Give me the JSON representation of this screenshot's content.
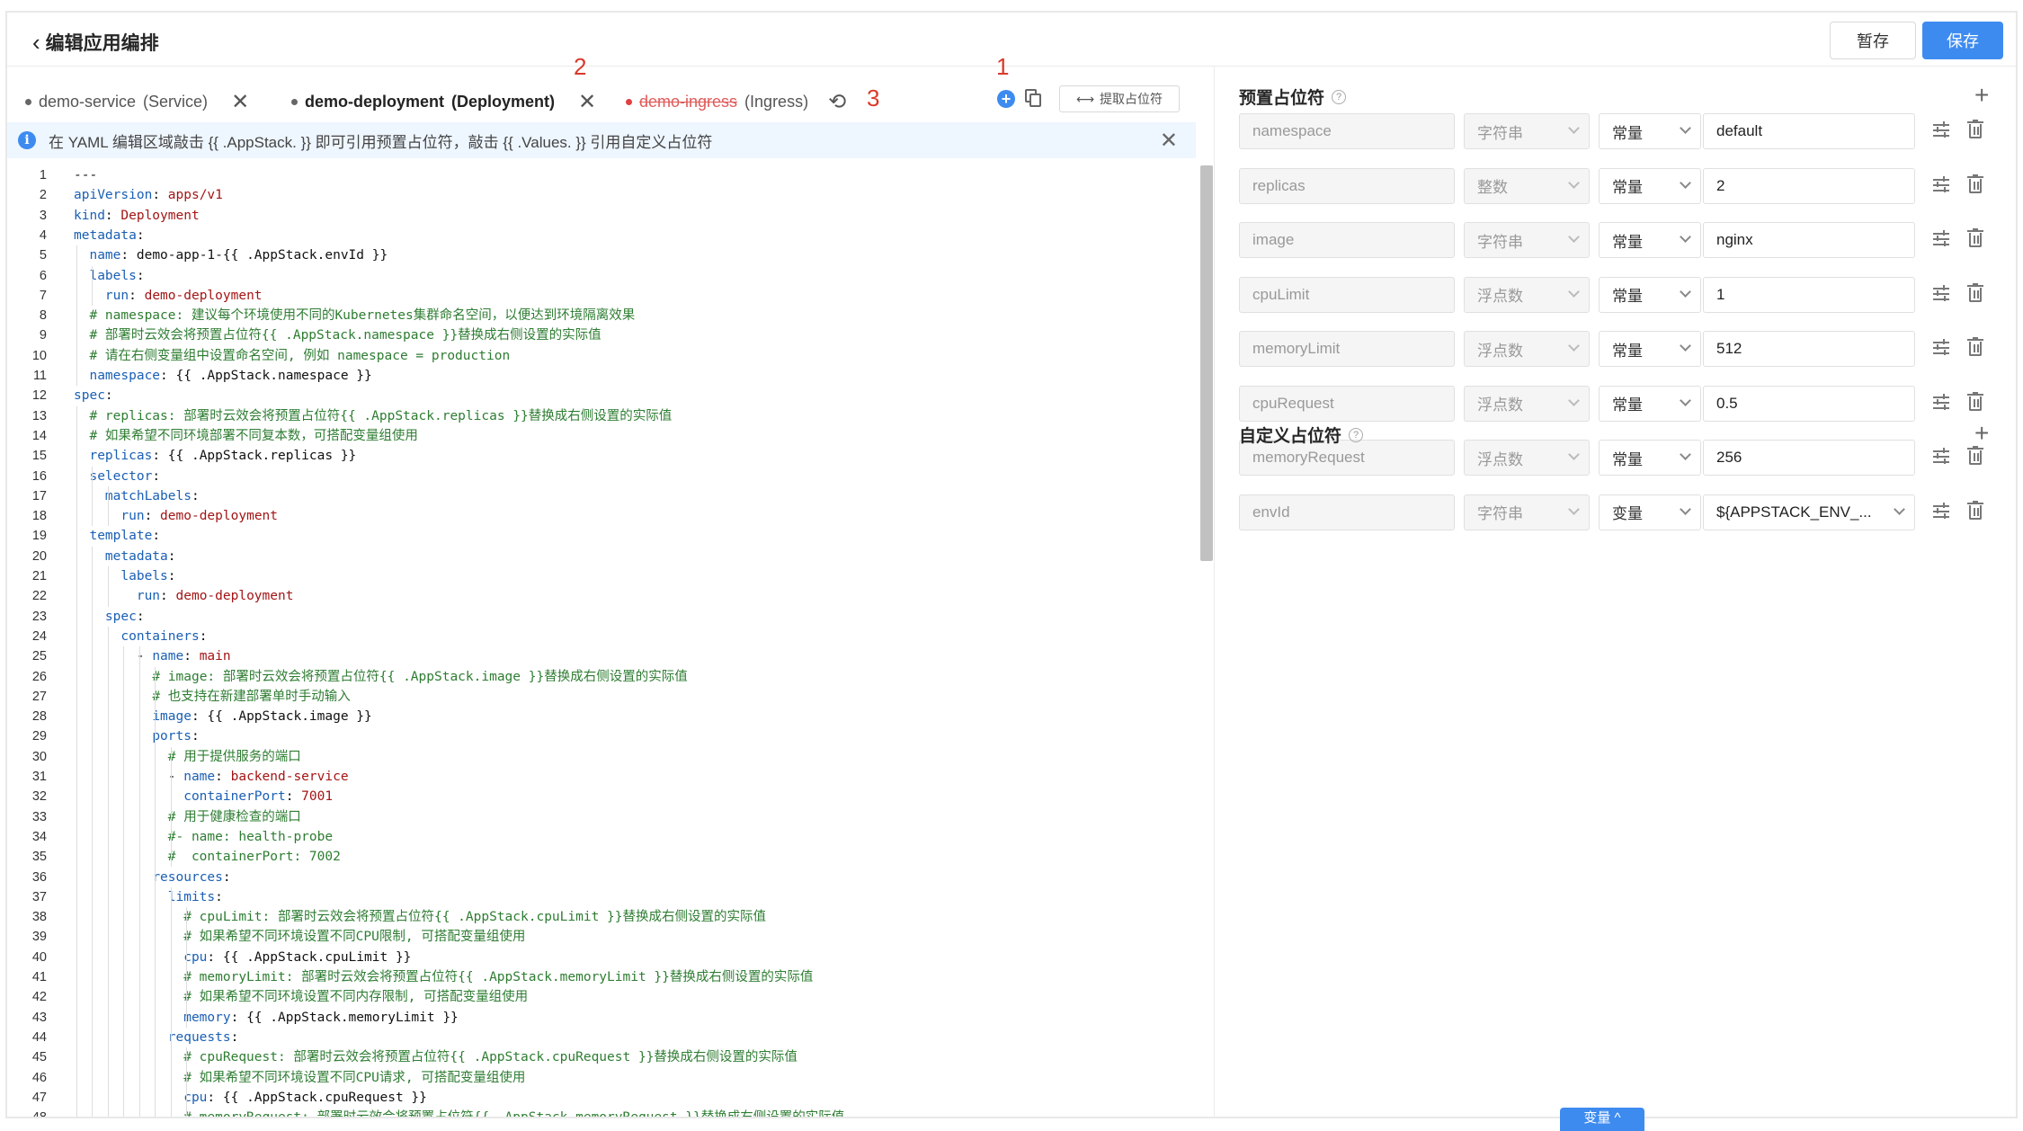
{
  "header": {
    "back_label": "编辑应用编排",
    "draft_label": "暂存",
    "save_label": "保存"
  },
  "tabs": [
    {
      "name": "demo-service",
      "kind": "(Service)"
    },
    {
      "name": "demo-deployment",
      "kind": "(Deployment)"
    },
    {
      "name": "demo-ingress",
      "kind": "(Ingress)"
    }
  ],
  "markers": [
    "1",
    "2",
    "3"
  ],
  "toolbar": {
    "extract_label": "提取占位符"
  },
  "notice": "在 YAML 编辑区域敲击 {{ .AppStack. }} 即可引用预置占位符，敲击 {{ .Values. }} 引用自定义占位符",
  "code_lines": [
    "---",
    "apiVersion: apps/v1",
    "kind: Deployment",
    "metadata:",
    "  name: demo-app-1-{{ .AppStack.envId }}",
    "  labels:",
    "    run: demo-deployment",
    "  # namespace: 建议每个环境使用不同的Kubernetes集群命名空间，以便达到环境隔离效果",
    "  # 部署时云效会将预置占位符{{ .AppStack.namespace }}替换成右侧设置的实际值",
    "  # 请在右侧变量组中设置命名空间, 例如 namespace = production",
    "  namespace: {{ .AppStack.namespace }}",
    "spec:",
    "  # replicas: 部署时云效会将预置占位符{{ .AppStack.replicas }}替换成右侧设置的实际值",
    "  # 如果希望不同环境部署不同复本数，可搭配变量组使用",
    "  replicas: {{ .AppStack.replicas }}",
    "  selector:",
    "    matchLabels:",
    "      run: demo-deployment",
    "  template:",
    "    metadata:",
    "      labels:",
    "        run: demo-deployment",
    "    spec:",
    "      containers:",
    "        - name: main",
    "          # image: 部署时云效会将预置占位符{{ .AppStack.image }}替换成右侧设置的实际值",
    "          # 也支持在新建部署单时手动输入",
    "          image: {{ .AppStack.image }}",
    "          ports:",
    "            # 用于提供服务的端口",
    "            - name: backend-service",
    "              containerPort: 7001",
    "            # 用于健康检查的端口",
    "            #- name: health-probe",
    "            #  containerPort: 7002",
    "          resources:",
    "            limits:",
    "              # cpuLimit: 部署时云效会将预置占位符{{ .AppStack.cpuLimit }}替换成右侧设置的实际值",
    "              # 如果希望不同环境设置不同CPU限制, 可搭配变量组使用",
    "              cpu: {{ .AppStack.cpuLimit }}",
    "              # memoryLimit: 部署时云效会将预置占位符{{ .AppStack.memoryLimit }}替换成右侧设置的实际值",
    "              # 如果希望不同环境设置不同内存限制, 可搭配变量组使用",
    "              memory: {{ .AppStack.memoryLimit }}",
    "            requests:",
    "              # cpuRequest: 部署时云效会将预置占位符{{ .AppStack.cpuRequest }}替换成右侧设置的实际值",
    "              # 如果希望不同环境设置不同CPU请求, 可搭配变量组使用",
    "              cpu: {{ .AppStack.cpuRequest }}",
    "              # memoryRequest: 部署时云效会将预置占位符{{ .AppStack.memoryRequest }}替换成右侧设置的实际值"
  ],
  "preset": {
    "title": "预置占位符",
    "rows": [
      {
        "name": "namespace",
        "type": "字符串",
        "mode": "常量",
        "value": "default"
      },
      {
        "name": "replicas",
        "type": "整数",
        "mode": "常量",
        "value": "2"
      },
      {
        "name": "image",
        "type": "字符串",
        "mode": "常量",
        "value": "nginx"
      },
      {
        "name": "cpuLimit",
        "type": "浮点数",
        "mode": "常量",
        "value": "1"
      },
      {
        "name": "memoryLimit",
        "type": "浮点数",
        "mode": "常量",
        "value": "512"
      },
      {
        "name": "cpuRequest",
        "type": "浮点数",
        "mode": "常量",
        "value": "0.5"
      },
      {
        "name": "memoryRequest",
        "type": "浮点数",
        "mode": "常量",
        "value": "256"
      },
      {
        "name": "envId",
        "type": "字符串",
        "mode": "变量",
        "value": "${APPSTACK_ENV_..."
      }
    ]
  },
  "custom": {
    "title": "自定义占位符"
  },
  "var_pill": "变量 ^",
  "colors": {
    "accent": "#3e8bf0",
    "marker": "#d93a2b",
    "comment": "#2e7d32",
    "key": "#1a5fb4",
    "value": "#a31515"
  }
}
